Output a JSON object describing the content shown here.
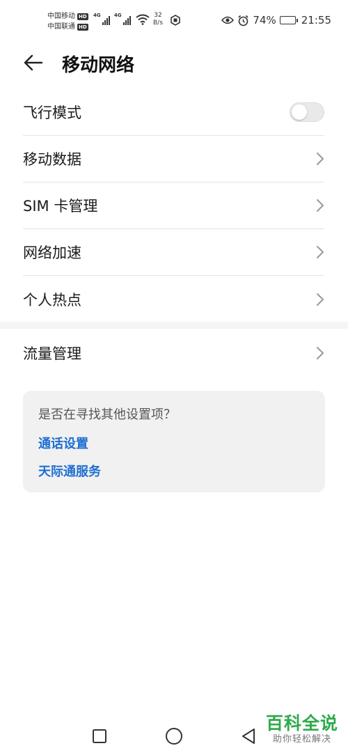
{
  "status_bar": {
    "carrier_1": "中国移动",
    "carrier_2": "中国联通",
    "hd_badge": "HD",
    "network_type_1": "4G",
    "network_type_2": "4G",
    "speed_value": "32",
    "speed_unit": "B/s",
    "battery_percent": "74%",
    "battery_level": 0.74,
    "time": "21:55"
  },
  "header": {
    "title": "移动网络"
  },
  "settings": {
    "items": [
      {
        "label": "飞行模式",
        "type": "toggle",
        "enabled": false
      },
      {
        "label": "移动数据",
        "type": "link"
      },
      {
        "label": "SIM 卡管理",
        "type": "link"
      },
      {
        "label": "网络加速",
        "type": "link"
      },
      {
        "label": "个人热点",
        "type": "link"
      }
    ],
    "section_2": [
      {
        "label": "流量管理",
        "type": "link"
      }
    ]
  },
  "suggestions": {
    "question": "是否在寻找其他设置项？",
    "links": [
      "通话设置",
      "天际通服务"
    ]
  },
  "watermark": {
    "title": "百科全说",
    "subtitle": "助你轻松解决"
  },
  "colors": {
    "link": "#1f6fd1",
    "watermark": "#2faa4a",
    "card_bg": "#f1f1f1"
  }
}
